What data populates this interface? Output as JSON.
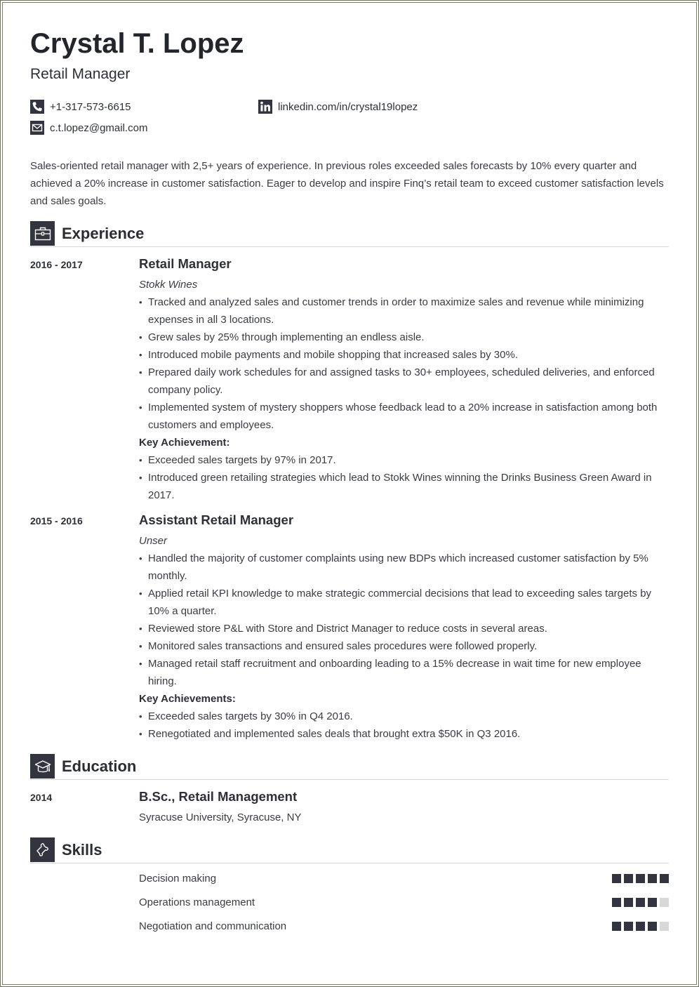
{
  "header": {
    "name": "Crystal T. Lopez",
    "title": "Retail Manager"
  },
  "contacts": {
    "phone": {
      "icon": "phone-icon",
      "text": "+1-317-573-6615"
    },
    "linkedin": {
      "icon": "linkedin-icon",
      "text": "linkedin.com/in/crystal19lopez"
    },
    "email": {
      "icon": "envelope-icon",
      "text": "c.t.lopez@gmail.com"
    }
  },
  "summary": "Sales-oriented retail manager with 2,5+ years of experience. In previous roles exceeded sales forecasts by 10% every quarter and achieved a 20% increase in customer satisfaction. Eager to develop and inspire Finq’s retail team to exceed customer satisfaction levels and sales goals.",
  "experience": {
    "heading": "Experience",
    "icon": "briefcase-icon",
    "jobs": [
      {
        "dates": "2016 - 2017",
        "title": "Retail Manager",
        "company": "Stokk Wines",
        "bullets": [
          "Tracked and analyzed sales and customer trends in order to maximize sales and revenue while minimizing expenses in all 3 locations.",
          "Grew sales by 25% through implementing an endless aisle.",
          "Introduced mobile payments and mobile shopping that increased sales by 30%.",
          "Prepared daily work schedules for and assigned tasks to 30+ employees, scheduled deliveries, and enforced company policy.",
          "Implemented system of mystery shoppers whose feedback lead to a 20% increase in satisfaction among both customers and employees."
        ],
        "achievements_label": "Key Achievement:",
        "achievements": [
          "Exceeded sales targets by 97% in 2017.",
          "Introduced green retailing strategies which lead to Stokk Wines winning the Drinks Business Green Award in 2017."
        ]
      },
      {
        "dates": "2015 - 2016",
        "title": "Assistant Retail Manager",
        "company": "Unser",
        "bullets": [
          "Handled the majority of customer complaints using new BDPs which increased customer satisfaction by 5% monthly.",
          "Applied retail KPI knowledge to make strategic commercial decisions that lead to exceeding sales targets by 10% a quarter.",
          "Reviewed store P&L with Store and District Manager to reduce costs in several areas.",
          "Monitored sales transactions and ensured sales procedures were followed properly.",
          "Managed retail staff recruitment and onboarding leading to a 15% decrease in wait time for new employee hiring."
        ],
        "achievements_label": "Key Achievements:",
        "achievements": [
          "Exceeded sales targets by 30% in Q4 2016.",
          "Renegotiated and implemented sales deals that brought extra $50K in Q3 2016."
        ]
      }
    ]
  },
  "education": {
    "heading": "Education",
    "icon": "graduation-cap-icon",
    "items": [
      {
        "year": "2014",
        "degree": "B.Sc., Retail Management",
        "school": "Syracuse University, Syracuse, NY"
      }
    ]
  },
  "skills": {
    "heading": "Skills",
    "icon": "puzzle-piece-icon",
    "scale_max": 5,
    "items": [
      {
        "name": "Decision making",
        "level": 5
      },
      {
        "name": "Operations management",
        "level": 4
      },
      {
        "name": "Negotiation and communication",
        "level": 4
      }
    ],
    "colors": {
      "filled": "#323540",
      "empty": "#d8d8d8"
    }
  }
}
